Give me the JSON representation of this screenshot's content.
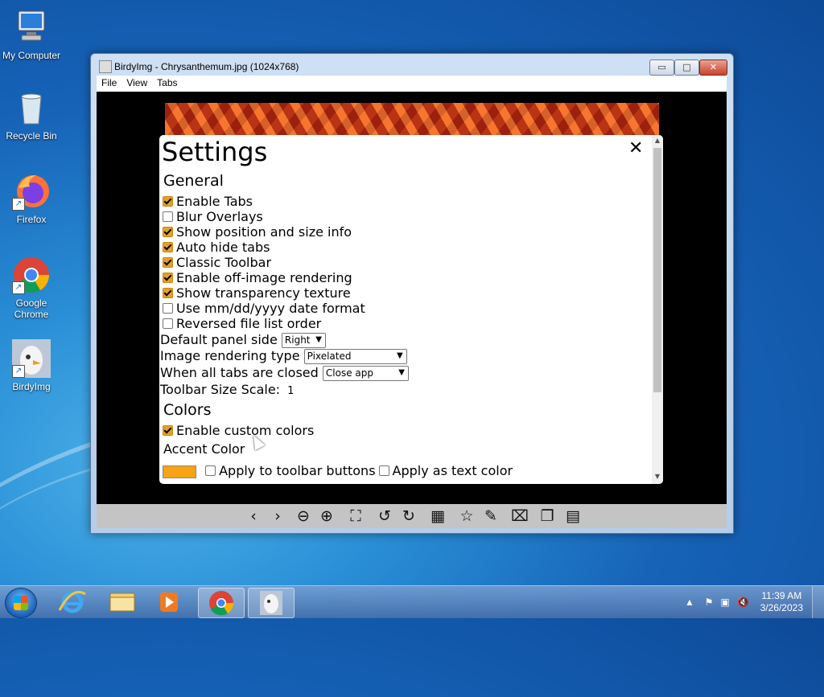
{
  "desktop": {
    "icons": [
      {
        "label": "My Computer"
      },
      {
        "label": "Recycle Bin"
      },
      {
        "label": "Firefox"
      },
      {
        "label": "Google Chrome"
      },
      {
        "label": "BirdyImg"
      }
    ]
  },
  "window": {
    "title": "BirdyImg - Chrysanthemum.jpg (1024x768)",
    "controls": {
      "minimize": "▭",
      "maximize": "□",
      "close": "✕"
    },
    "menu": [
      "File",
      "View",
      "Tabs"
    ]
  },
  "settings": {
    "title": "Settings",
    "close_glyph": "✕",
    "general_heading": "General",
    "checkboxes": [
      {
        "label": "Enable Tabs",
        "checked": true
      },
      {
        "label": "Blur Overlays",
        "checked": false
      },
      {
        "label": "Show position and size info",
        "checked": true
      },
      {
        "label": "Auto hide tabs",
        "checked": true
      },
      {
        "label": "Classic Toolbar",
        "checked": true
      },
      {
        "label": "Enable off-image rendering",
        "checked": true
      },
      {
        "label": "Show transparency texture",
        "checked": true
      },
      {
        "label": "Use mm/dd/yyyy date format",
        "checked": false
      },
      {
        "label": "Reversed file list order",
        "checked": false
      }
    ],
    "default_panel_side": {
      "label": "Default panel side",
      "value": "Right"
    },
    "image_rendering_type": {
      "label": "Image rendering type",
      "value": "Pixelated"
    },
    "when_tabs_closed": {
      "label": "When all tabs are closed",
      "value": "Close app"
    },
    "toolbar_size_scale": {
      "label": "Toolbar Size Scale:",
      "value": "1"
    },
    "colors_heading": "Colors",
    "enable_custom_colors": {
      "label": "Enable custom colors",
      "checked": true
    },
    "accent_color": {
      "label": "Accent Color",
      "value": "#f7a315"
    },
    "apply_toolbar": {
      "label": "Apply to toolbar buttons",
      "checked": false
    },
    "apply_text": {
      "label": "Apply as text color",
      "checked": false
    }
  },
  "toolbar": {
    "buttons": [
      {
        "name": "previous-icon",
        "glyph": "‹"
      },
      {
        "name": "next-icon",
        "glyph": "›"
      },
      {
        "name": "zoom-out-icon",
        "glyph": "⊖"
      },
      {
        "name": "zoom-in-icon",
        "glyph": "⊕"
      },
      {
        "name": "fit-screen-icon",
        "glyph": "⛶"
      },
      {
        "name": "rotate-left-icon",
        "glyph": "↺"
      },
      {
        "name": "rotate-right-icon",
        "glyph": "↻"
      },
      {
        "name": "grid-icon",
        "glyph": "▦"
      },
      {
        "name": "star-icon",
        "glyph": "☆"
      },
      {
        "name": "edit-icon",
        "glyph": "✎"
      },
      {
        "name": "delete-icon",
        "glyph": "⌧"
      },
      {
        "name": "copy-icon",
        "glyph": "❐"
      },
      {
        "name": "gallery-icon",
        "glyph": "▤"
      }
    ]
  },
  "taskbar": {
    "clock_time": "11:39 AM",
    "clock_date": "3/26/2023"
  }
}
